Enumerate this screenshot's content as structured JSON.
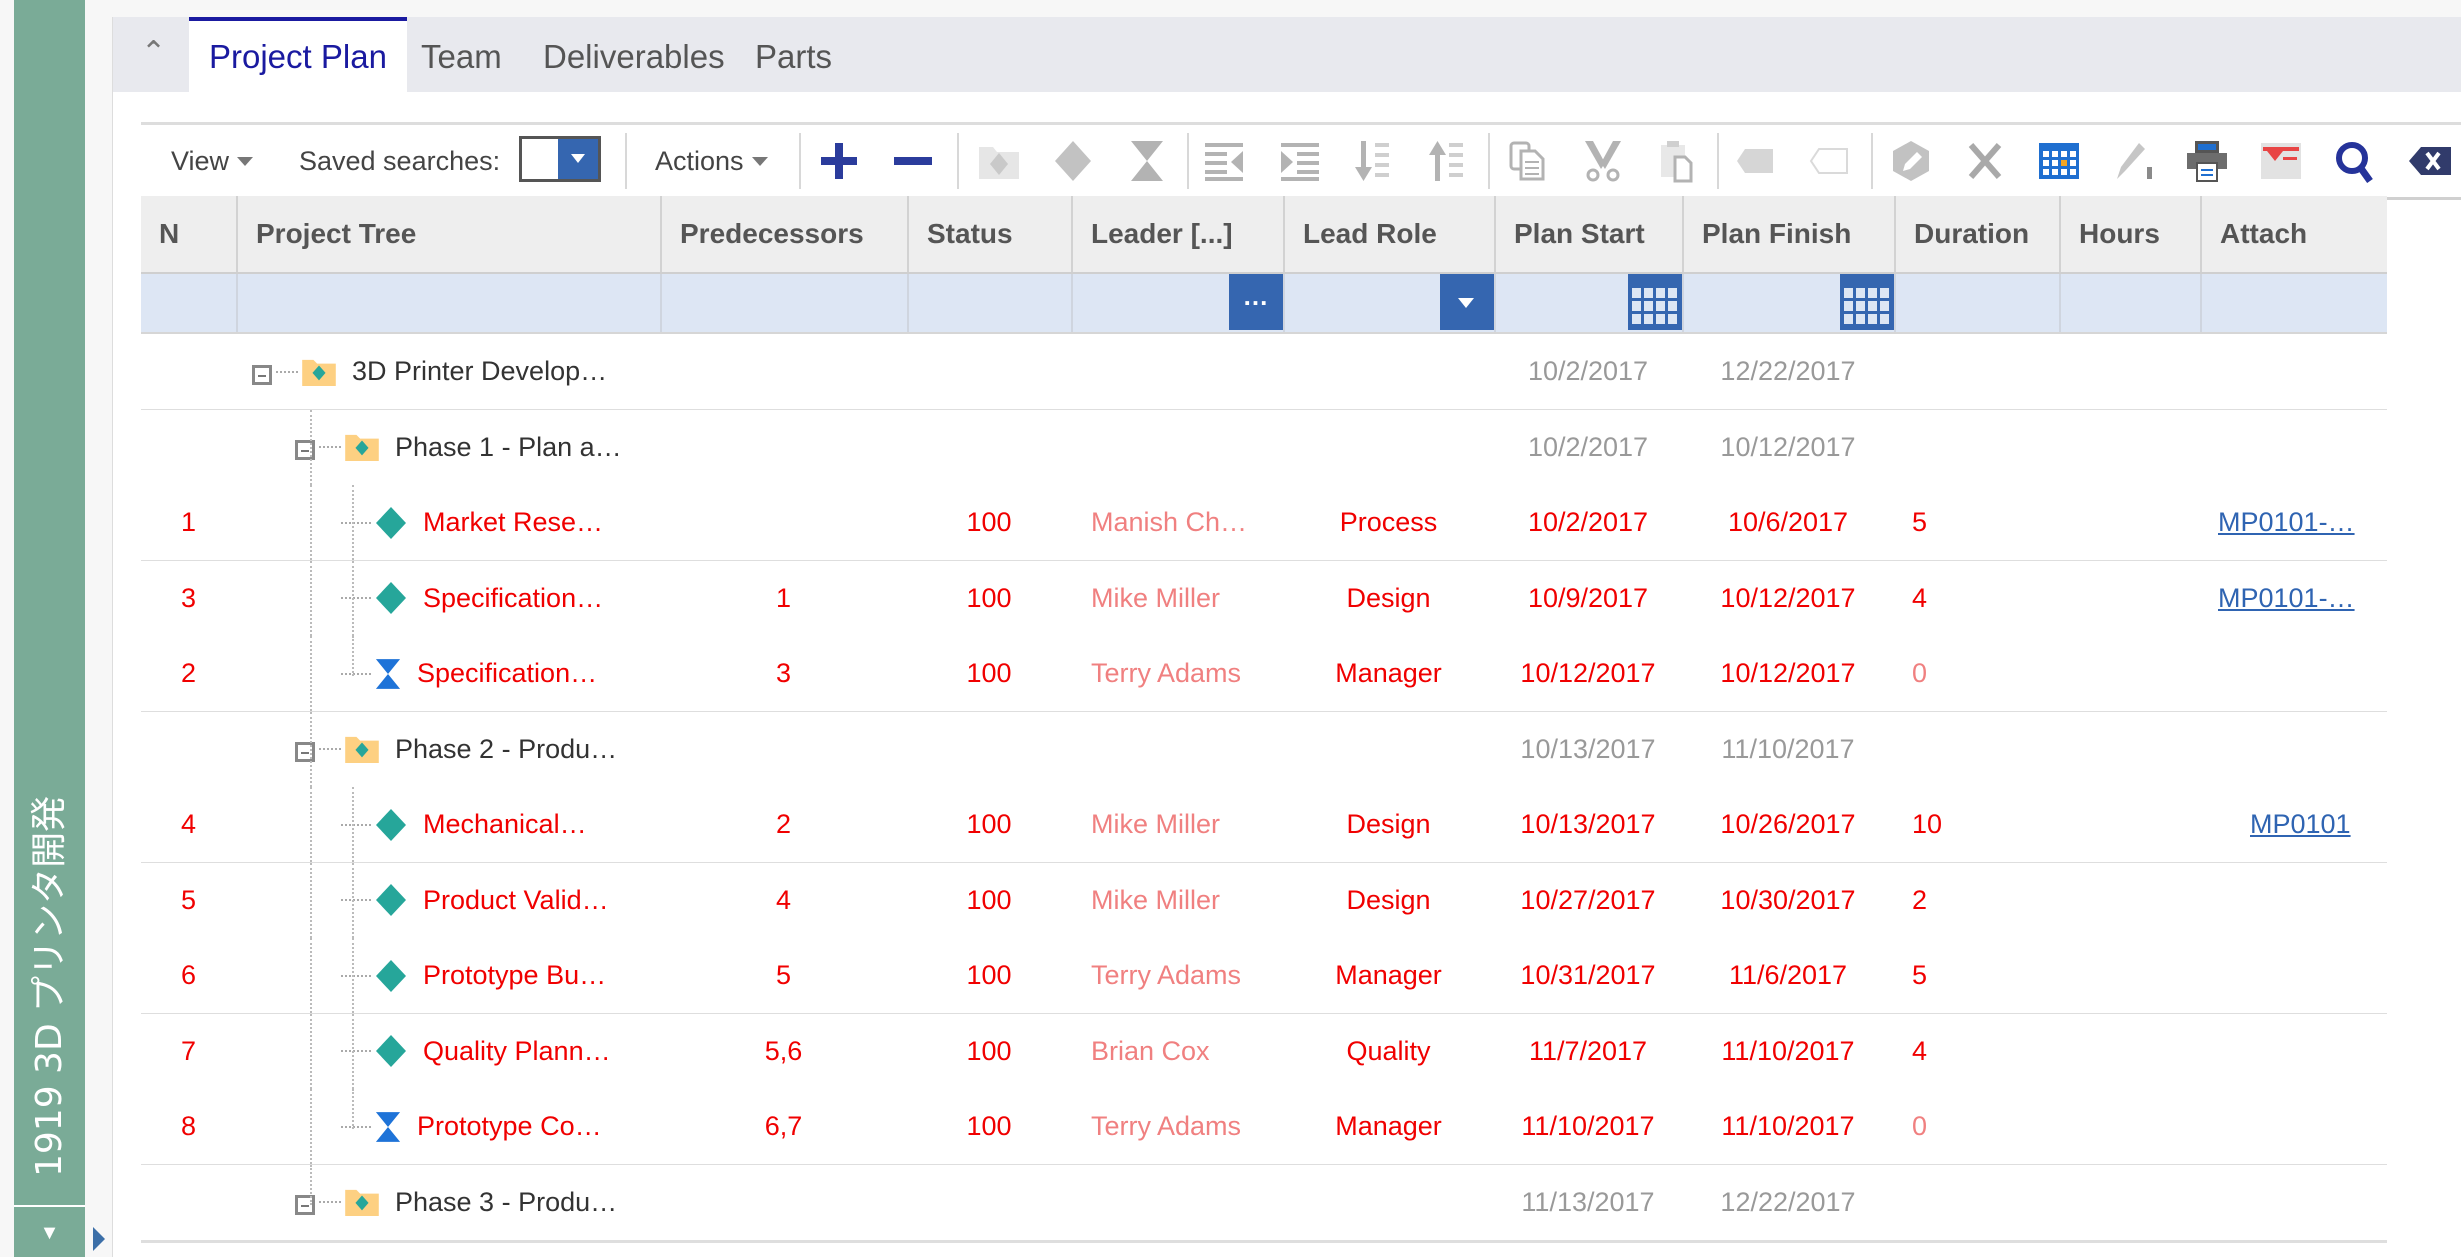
{
  "sidebar": {
    "title": "1919 3D プリンタ開発",
    "collapse_icon": "triangle-down",
    "expand_icon": "triangle-right"
  },
  "tabs": {
    "collapse_icon": "chevron-up",
    "items": [
      {
        "label": "Project Plan",
        "active": true
      },
      {
        "label": "Team",
        "active": false
      },
      {
        "label": "Deliverables",
        "active": false
      },
      {
        "label": "Parts",
        "active": false
      }
    ]
  },
  "toolbar": {
    "view_label": "View",
    "saved_searches_label": "Saved searches:",
    "saved_searches_value": "",
    "actions_label": "Actions",
    "icons": [
      {
        "name": "add-icon",
        "enabled": true
      },
      {
        "name": "remove-icon",
        "enabled": true
      },
      {
        "name": "add-folder-milestone-icon",
        "enabled": false
      },
      {
        "name": "milestone-diamond-icon",
        "enabled": false
      },
      {
        "name": "hourglass-icon",
        "enabled": false
      },
      {
        "name": "outdent-icon",
        "enabled": false
      },
      {
        "name": "indent-icon",
        "enabled": false
      },
      {
        "name": "move-down-icon",
        "enabled": false
      },
      {
        "name": "move-up-icon",
        "enabled": false
      },
      {
        "name": "copy-icon",
        "enabled": false
      },
      {
        "name": "cut-icon",
        "enabled": false
      },
      {
        "name": "paste-icon",
        "enabled": false
      },
      {
        "name": "tag-filled-icon",
        "enabled": false
      },
      {
        "name": "tag-outline-icon",
        "enabled": false
      },
      {
        "name": "edit-icon",
        "enabled": false
      },
      {
        "name": "delete-icon",
        "enabled": false
      },
      {
        "name": "calendar-grid-icon",
        "enabled": true
      },
      {
        "name": "sign-icon",
        "enabled": false
      },
      {
        "name": "print-icon",
        "enabled": true
      },
      {
        "name": "clear-filter-icon",
        "enabled": true
      },
      {
        "name": "search-icon",
        "enabled": true
      },
      {
        "name": "clear-search-icon",
        "enabled": true
      }
    ]
  },
  "grid": {
    "columns": [
      {
        "key": "n",
        "label": "N"
      },
      {
        "key": "tree",
        "label": "Project Tree"
      },
      {
        "key": "pred",
        "label": "Predecessors"
      },
      {
        "key": "status",
        "label": "Status"
      },
      {
        "key": "leader",
        "label": "Leader [...]"
      },
      {
        "key": "role",
        "label": "Lead Role"
      },
      {
        "key": "start",
        "label": "Plan Start"
      },
      {
        "key": "finish",
        "label": "Plan Finish"
      },
      {
        "key": "duration",
        "label": "Duration"
      },
      {
        "key": "hours",
        "label": "Hours"
      },
      {
        "key": "attach",
        "label": "Attach"
      }
    ],
    "filter_buttons": {
      "leader": "...",
      "role": "dropdown",
      "start": "calendar",
      "finish": "calendar"
    },
    "rows": [
      {
        "type": "project",
        "level": 0,
        "n": "",
        "name": "3D Printer Develop…",
        "pred": "",
        "status": "",
        "leader": "",
        "role": "",
        "start": "10/2/2017",
        "finish": "12/22/2017",
        "duration": "",
        "hours": "",
        "attach": ""
      },
      {
        "type": "phase",
        "level": 1,
        "n": "",
        "name": "Phase 1 - Plan a…",
        "pred": "",
        "status": "",
        "leader": "",
        "role": "",
        "start": "10/2/2017",
        "finish": "10/12/2017",
        "duration": "",
        "hours": "",
        "attach": ""
      },
      {
        "type": "task",
        "level": 2,
        "n": "1",
        "name": "Market Rese…",
        "pred": "",
        "status": "100",
        "leader": "Manish Ch…",
        "role": "Process",
        "start": "10/2/2017",
        "finish": "10/6/2017",
        "duration": "5",
        "hours": "",
        "attach": "MP0101-…"
      },
      {
        "type": "task",
        "level": 2,
        "n": "3",
        "name": "Specification…",
        "pred": "1",
        "status": "100",
        "leader": "Mike Miller",
        "role": "Design",
        "start": "10/9/2017",
        "finish": "10/12/2017",
        "duration": "4",
        "hours": "",
        "attach": "MP0101-…"
      },
      {
        "type": "milestone",
        "level": 2,
        "last": true,
        "n": "2",
        "name": "Specification…",
        "pred": "3",
        "status": "100",
        "leader": "Terry Adams",
        "role": "Manager",
        "start": "10/12/2017",
        "finish": "10/12/2017",
        "duration": "0",
        "hours": "",
        "attach": ""
      },
      {
        "type": "phase",
        "level": 1,
        "n": "",
        "name": "Phase 2 - Produ…",
        "pred": "",
        "status": "",
        "leader": "",
        "role": "",
        "start": "10/13/2017",
        "finish": "11/10/2017",
        "duration": "",
        "hours": "",
        "attach": ""
      },
      {
        "type": "task",
        "level": 2,
        "n": "4",
        "name": "Mechanical…",
        "pred": "2",
        "status": "100",
        "leader": "Mike Miller",
        "role": "Design",
        "start": "10/13/2017",
        "finish": "10/26/2017",
        "duration": "10",
        "hours": "",
        "attach": "MP0101"
      },
      {
        "type": "task",
        "level": 2,
        "n": "5",
        "name": "Product Valid…",
        "pred": "4",
        "status": "100",
        "leader": "Mike Miller",
        "role": "Design",
        "start": "10/27/2017",
        "finish": "10/30/2017",
        "duration": "2",
        "hours": "",
        "attach": ""
      },
      {
        "type": "task",
        "level": 2,
        "n": "6",
        "name": "Prototype Bu…",
        "pred": "5",
        "status": "100",
        "leader": "Terry Adams",
        "role": "Manager",
        "start": "10/31/2017",
        "finish": "11/6/2017",
        "duration": "5",
        "hours": "",
        "attach": ""
      },
      {
        "type": "task",
        "level": 2,
        "n": "7",
        "name": "Quality Plann…",
        "pred": "5,6",
        "status": "100",
        "leader": "Brian Cox",
        "role": "Quality",
        "start": "11/7/2017",
        "finish": "11/10/2017",
        "duration": "4",
        "hours": "",
        "attach": ""
      },
      {
        "type": "milestone",
        "level": 2,
        "last": true,
        "n": "8",
        "name": "Prototype Co…",
        "pred": "6,7",
        "status": "100",
        "leader": "Terry Adams",
        "role": "Manager",
        "start": "11/10/2017",
        "finish": "11/10/2017",
        "duration": "0",
        "hours": "",
        "attach": ""
      },
      {
        "type": "phase",
        "level": 1,
        "n": "",
        "name": "Phase 3 - Produ…",
        "pred": "",
        "status": "",
        "leader": "",
        "role": "",
        "start": "11/13/2017",
        "finish": "12/22/2017",
        "duration": "",
        "hours": "",
        "attach": ""
      }
    ]
  },
  "colors": {
    "sidebar": "#7aab97",
    "active_tab": "#1a1aa0",
    "accent_blue": "#3566b0",
    "task_text": "#f00000",
    "leader_text": "#f08080",
    "summary_text": "#999999",
    "milestone_icon": "#26a69a",
    "hourglass_icon": "#1e73d8",
    "folder_icon": "#fdd082"
  }
}
